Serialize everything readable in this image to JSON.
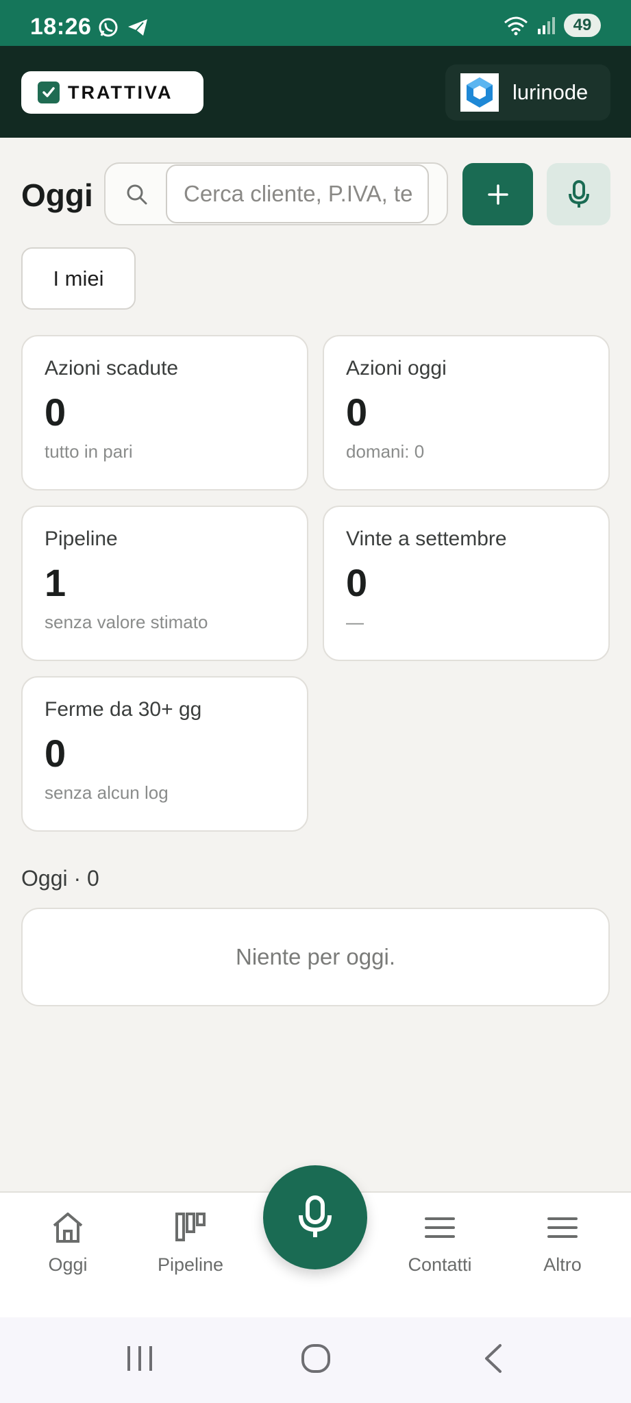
{
  "status_bar": {
    "time": "18:26",
    "battery": "49"
  },
  "header": {
    "logo_text": "TRATTIVA",
    "org_name": "lurinode"
  },
  "toolbar": {
    "title": "Oggi",
    "search_placeholder": "Cerca cliente, P.IVA, te"
  },
  "filter": {
    "label": "I miei"
  },
  "cards": [
    {
      "title": "Azioni scadute",
      "value": "0",
      "sub": "tutto in pari"
    },
    {
      "title": "Azioni oggi",
      "value": "0",
      "sub": "domani: 0"
    },
    {
      "title": "Pipeline",
      "value": "1",
      "sub": "senza valore stimato"
    },
    {
      "title": "Vinte a settembre",
      "value": "0",
      "sub": "—"
    },
    {
      "title": "Ferme da 30+ gg",
      "value": "0",
      "sub": "senza alcun log"
    }
  ],
  "today_section": {
    "title": "Oggi · 0",
    "empty_text": "Niente per oggi."
  },
  "bottom_nav": [
    {
      "label": "Oggi",
      "icon": "home-icon"
    },
    {
      "label": "Pipeline",
      "icon": "pipeline-icon"
    },
    {
      "label": "Contatti",
      "icon": "menu-icon"
    },
    {
      "label": "Altro",
      "icon": "menu-icon"
    }
  ],
  "colors": {
    "brand": "#15765a",
    "header_bg": "#122a22",
    "accent": "#1a6b53"
  }
}
